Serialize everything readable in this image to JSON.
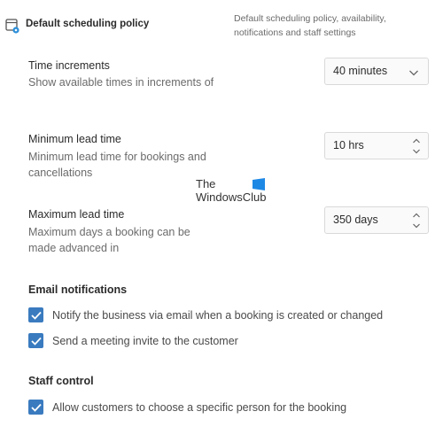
{
  "header": {
    "title": "Default scheduling policy",
    "description": "Default scheduling policy, availability, notifications and staff settings",
    "icon": "calendar-settings-icon"
  },
  "time_increments": {
    "label": "Time increments",
    "description": "Show available times in increments of",
    "value": "40 minutes"
  },
  "min_lead_time": {
    "label": "Minimum lead time",
    "description": "Minimum lead time for bookings and cancellations",
    "value": "10 hrs"
  },
  "max_lead_time": {
    "label": "Maximum lead time",
    "description": "Maximum days a booking can be made advanced in",
    "value": "350 days"
  },
  "watermark": {
    "line1": "The",
    "line2": "WindowsClub"
  },
  "email_notifications": {
    "title": "Email notifications",
    "items": [
      {
        "label": "Notify the business via email when a booking is created or changed",
        "checked": true
      },
      {
        "label": "Send a meeting invite to the customer",
        "checked": true
      }
    ]
  },
  "staff_control": {
    "title": "Staff control",
    "items": [
      {
        "label": "Allow customers to choose a specific person for the booking",
        "checked": true
      }
    ]
  },
  "colors": {
    "checkbox": "#3a7bbf",
    "icon_accent": "#2d8fd8",
    "watermark_logo": "#1e88e5"
  }
}
